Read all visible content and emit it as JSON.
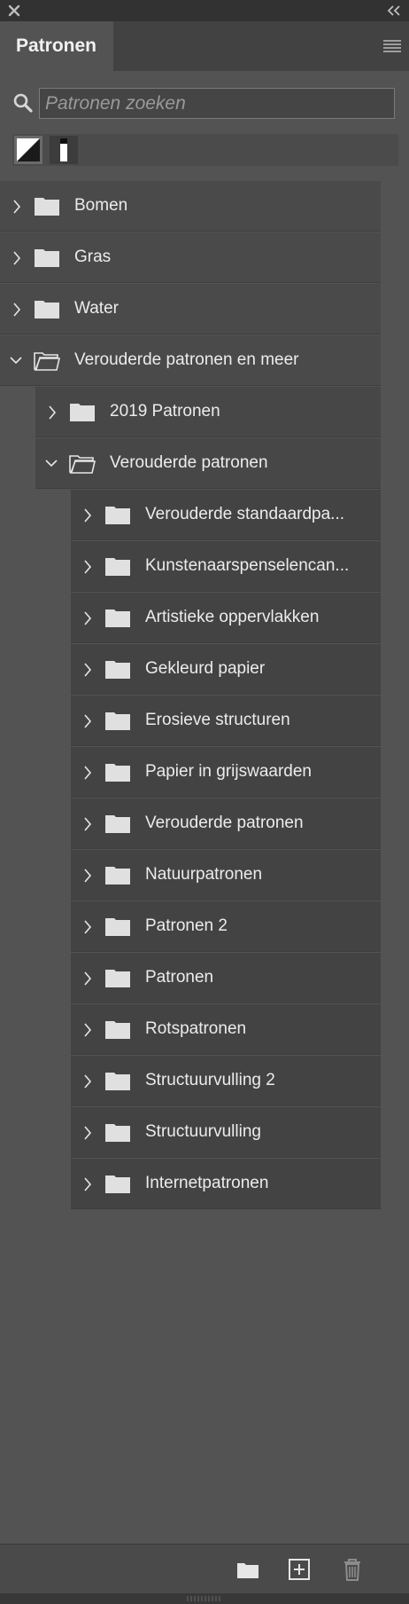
{
  "panel": {
    "title": "Patronen",
    "close_icon": "close-icon",
    "collapse_icon": "double-chevron-left-icon",
    "menu_icon": "hamburger-menu-icon"
  },
  "search": {
    "placeholder": "Patronen zoeken",
    "value": ""
  },
  "swatches": [
    "diagonal-pattern-swatch",
    "vertical-bar-pattern-swatch"
  ],
  "tree": [
    {
      "label": "Bomen",
      "level": 0,
      "expanded": false
    },
    {
      "label": "Gras",
      "level": 0,
      "expanded": false
    },
    {
      "label": "Water",
      "level": 0,
      "expanded": false
    },
    {
      "label": "Verouderde patronen en meer",
      "level": 0,
      "expanded": true
    },
    {
      "label": "2019 Patronen",
      "level": 1,
      "expanded": false
    },
    {
      "label": "Verouderde patronen",
      "level": 1,
      "expanded": true
    },
    {
      "label": "Verouderde standaardpa...",
      "level": 2,
      "expanded": false
    },
    {
      "label": "Kunstenaarspenselencan...",
      "level": 2,
      "expanded": false
    },
    {
      "label": "Artistieke oppervlakken",
      "level": 2,
      "expanded": false
    },
    {
      "label": "Gekleurd papier",
      "level": 2,
      "expanded": false
    },
    {
      "label": "Erosieve structuren",
      "level": 2,
      "expanded": false
    },
    {
      "label": "Papier in grijswaarden",
      "level": 2,
      "expanded": false
    },
    {
      "label": "Verouderde patronen",
      "level": 2,
      "expanded": false
    },
    {
      "label": "Natuurpatronen",
      "level": 2,
      "expanded": false
    },
    {
      "label": "Patronen 2",
      "level": 2,
      "expanded": false
    },
    {
      "label": "Patronen",
      "level": 2,
      "expanded": false
    },
    {
      "label": "Rotspatronen",
      "level": 2,
      "expanded": false
    },
    {
      "label": "Structuurvulling 2",
      "level": 2,
      "expanded": false
    },
    {
      "label": "Structuurvulling",
      "level": 2,
      "expanded": false
    },
    {
      "label": "Internetpatronen",
      "level": 2,
      "expanded": false
    }
  ],
  "footer": {
    "new_group_icon": "folder-icon",
    "new_pattern_icon": "add-square-icon",
    "delete_icon": "trash-icon"
  },
  "colors": {
    "panel_bg": "#535353",
    "icon_fg": "#e6e6e6"
  }
}
